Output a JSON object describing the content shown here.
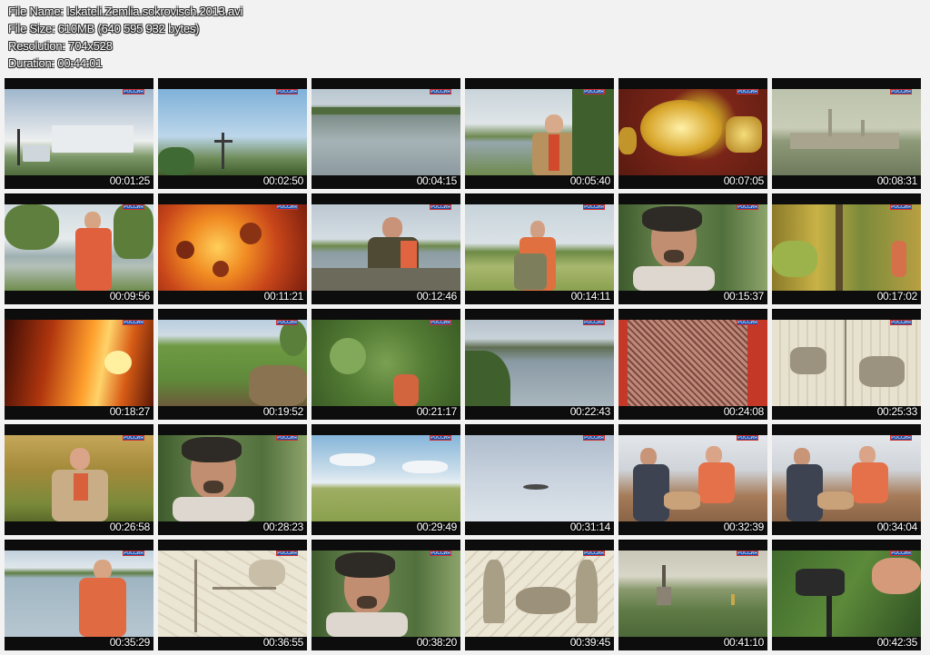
{
  "header": {
    "file_name": "File Name: Iskateli.Zemlia.sokrovisch.2013.avi",
    "file_size": "File Size: 610MB (640 595 932 bytes)",
    "resolution": "Resolution: 704x528",
    "duration": "Duration: 00:44:01"
  },
  "channel_logo": "РОССИЯ",
  "frames": [
    {
      "time": "00:01:25",
      "scene": "sky-clouds-town-sign"
    },
    {
      "time": "00:02:50",
      "scene": "sky-orthodox-cross"
    },
    {
      "time": "00:04:15",
      "scene": "river-landscape"
    },
    {
      "time": "00:05:40",
      "scene": "man-by-river"
    },
    {
      "time": "00:07:05",
      "scene": "golden-treasure"
    },
    {
      "time": "00:08:31",
      "scene": "painting-kremlin"
    },
    {
      "time": "00:09:56",
      "scene": "man-red-shirt-river"
    },
    {
      "time": "00:11:21",
      "scene": "fire-closeup"
    },
    {
      "time": "00:12:46",
      "scene": "man-in-boat"
    },
    {
      "time": "00:14:11",
      "scene": "man-in-field"
    },
    {
      "time": "00:15:37",
      "scene": "bearded-man-forest"
    },
    {
      "time": "00:17:02",
      "scene": "autumn-forest"
    },
    {
      "time": "00:18:27",
      "scene": "flames"
    },
    {
      "time": "00:19:52",
      "scene": "grassy-hill"
    },
    {
      "time": "00:21:17",
      "scene": "green-foliage"
    },
    {
      "time": "00:22:43",
      "scene": "river-valley"
    },
    {
      "time": "00:24:08",
      "scene": "chainmail"
    },
    {
      "time": "00:25:33",
      "scene": "old-drawing-battle"
    },
    {
      "time": "00:26:58",
      "scene": "man-in-reeds"
    },
    {
      "time": "00:28:23",
      "scene": "bearded-man-forest"
    },
    {
      "time": "00:29:49",
      "scene": "meadow-sky"
    },
    {
      "time": "00:31:14",
      "scene": "bird-in-sky"
    },
    {
      "time": "00:32:39",
      "scene": "two-men-studio"
    },
    {
      "time": "00:34:04",
      "scene": "two-men-studio"
    },
    {
      "time": "00:35:29",
      "scene": "man-by-lake"
    },
    {
      "time": "00:36:55",
      "scene": "old-map"
    },
    {
      "time": "00:38:20",
      "scene": "bearded-man-forest"
    },
    {
      "time": "00:39:45",
      "scene": "old-drawing-people"
    },
    {
      "time": "00:41:10",
      "scene": "church-aerial"
    },
    {
      "time": "00:42:35",
      "scene": "metal-detector"
    }
  ]
}
